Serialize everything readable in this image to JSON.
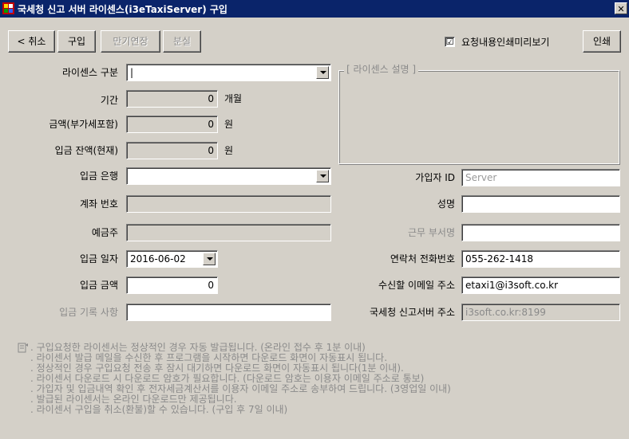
{
  "window": {
    "title": "국세청 신고 서버 라이센스(i3eTaxiServer) 구입",
    "close_label": "✕"
  },
  "toolbar": {
    "cancel_label": "< 취소",
    "buy_label": "구입",
    "extend_label": "만기연장",
    "lost_label": "분실",
    "preview_checked": "☑",
    "preview_label": "요청내용인쇄미리보기",
    "print_label": "인쇄"
  },
  "form": {
    "license_type": {
      "label": "라이센스 구분",
      "value": "|"
    },
    "period": {
      "label": "기간",
      "value": "0",
      "unit": "개월"
    },
    "amount": {
      "label": "금액(부가세포함)",
      "value": "0",
      "unit": "원"
    },
    "balance": {
      "label": "입금 잔액(현재)",
      "value": "0",
      "unit": "원"
    },
    "bank": {
      "label": "입금 은행",
      "value": ""
    },
    "account_no": {
      "label": "계좌 번호",
      "value": ""
    },
    "depositor": {
      "label": "예금주",
      "value": ""
    },
    "deposit_date": {
      "label": "입금 일자",
      "value": "2016-06-02"
    },
    "deposit_amount": {
      "label": "입금 금액",
      "value": "0"
    },
    "deposit_note": {
      "label": "입금 기록 사항",
      "value": ""
    }
  },
  "license_desc": {
    "title": "[ 라이센스 설명 ]"
  },
  "user": {
    "join_id": {
      "label": "가입자 ID",
      "value": "",
      "placeholder": "Server"
    },
    "name": {
      "label": "성명",
      "value": ""
    },
    "department": {
      "label": "근무 부서명",
      "value": ""
    },
    "phone": {
      "label": "연락처 전화번호",
      "value": "055-262-1418"
    },
    "email": {
      "label": "수신할 이메일 주소",
      "value": "etaxi1@i3soft.co.kr"
    },
    "server": {
      "label": "국세청 신고서버 주소",
      "value": "i3soft.co.kr:8199"
    }
  },
  "notes": {
    "icon": "memo-icon",
    "lines": [
      ". 구입요청한 라이센서는 정상적인 경우 자동 발급됩니다. (온라인 접수 후 1분 이내)",
      ". 라이센서 발급 메일을 수신한 후 프로그램을 시작하면 다운로드 화면이 자동표시 됩니다.",
      ". 정상적인 경우 구입요청 전송 후 잠시 대기하면 다운로드 화면이 자동표시 됩니다(1분 이내).",
      ". 라이센서 다운로드 시 다운로드 암호가 필요합니다. (다운로드 암호는 이용자 이메일 주소로 통보)",
      ". 가입자 및 입금내역 확인 후 전자세금계산서를 이용자 이메일 주소로 송부하여 드립니다. (3영업일 이내)",
      ". 발급된 라이센서는 온라인 다운로드만 제공됩니다.",
      ". 라이센서 구입을 취소(환불)할 수 있습니다. (구입 후 7일 이내)"
    ]
  },
  "colors": {
    "titlebar": "#0a246a",
    "face": "#d4d0c8"
  }
}
